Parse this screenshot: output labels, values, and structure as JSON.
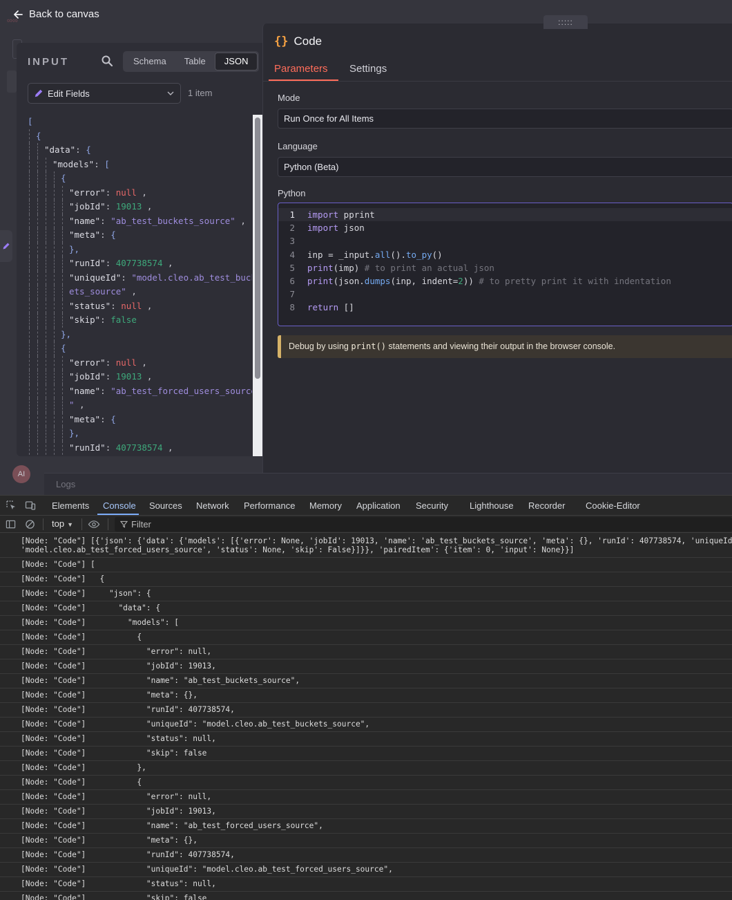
{
  "nav": {
    "back_label": "Back to canvas"
  },
  "canvas": {
    "logo_text": "∞∞",
    "ai_badge": "AI",
    "logs_label": "Logs"
  },
  "input": {
    "title": "INPUT",
    "view_tabs": [
      "Schema",
      "Table",
      "JSON"
    ],
    "active_view": "JSON",
    "node_selector": "Edit Fields",
    "item_count": "1 item",
    "json_lines": [
      {
        "i": 0,
        "k": "",
        "v": "[",
        "t": "p"
      },
      {
        "i": 1,
        "k": "",
        "v": "{",
        "t": "p"
      },
      {
        "i": 2,
        "k": "\"data\"",
        "v": "{",
        "t": "p"
      },
      {
        "i": 3,
        "k": "\"models\"",
        "v": "[",
        "t": "p"
      },
      {
        "i": 4,
        "k": "",
        "v": "{",
        "t": "p"
      },
      {
        "i": 5,
        "k": "\"error\"",
        "v": "null",
        "t": "null",
        "c": true
      },
      {
        "i": 5,
        "k": "\"jobId\"",
        "v": "19013",
        "t": "num",
        "c": true
      },
      {
        "i": 5,
        "k": "\"name\"",
        "v": "\"ab_test_buckets_source\"",
        "t": "str",
        "c": true
      },
      {
        "i": 5,
        "k": "\"meta\"",
        "v": "{",
        "t": "p"
      },
      {
        "i": 5,
        "k": "",
        "v": "},",
        "t": "p"
      },
      {
        "i": 5,
        "k": "\"runId\"",
        "v": "407738574",
        "t": "num",
        "c": true
      },
      {
        "i": 5,
        "k": "\"uniqueId\"",
        "v": "\"model.cleo.ab_test_buck",
        "t": "str"
      },
      {
        "i": 5,
        "k": "",
        "v": "    ets_source\"",
        "t": "str",
        "c": true
      },
      {
        "i": 5,
        "k": "\"status\"",
        "v": "null",
        "t": "null",
        "c": true
      },
      {
        "i": 5,
        "k": "\"skip\"",
        "v": "false",
        "t": "bool"
      },
      {
        "i": 4,
        "k": "",
        "v": "},",
        "t": "p"
      },
      {
        "i": 4,
        "k": "",
        "v": "{",
        "t": "p"
      },
      {
        "i": 5,
        "k": "\"error\"",
        "v": "null",
        "t": "null",
        "c": true
      },
      {
        "i": 5,
        "k": "\"jobId\"",
        "v": "19013",
        "t": "num",
        "c": true
      },
      {
        "i": 5,
        "k": "\"name\"",
        "v": "\"ab_test_forced_users_source",
        "t": "str"
      },
      {
        "i": 5,
        "k": "",
        "v": "     \"",
        "t": "str",
        "c": true
      },
      {
        "i": 5,
        "k": "\"meta\"",
        "v": "{",
        "t": "p"
      },
      {
        "i": 5,
        "k": "",
        "v": "},",
        "t": "p"
      },
      {
        "i": 5,
        "k": "\"runId\"",
        "v": "407738574",
        "t": "num",
        "c": true
      }
    ]
  },
  "node": {
    "icon": "{}",
    "title": "Code",
    "tabs": [
      "Parameters",
      "Settings"
    ],
    "active_tab": "Parameters",
    "mode_label": "Mode",
    "mode_value": "Run Once for All Items",
    "language_label": "Language",
    "language_value": "Python (Beta)",
    "editor_label": "Python",
    "code_lines": [
      {
        "n": "1",
        "html": "<span class=\"kw\">import</span> pprint"
      },
      {
        "n": "2",
        "html": "<span class=\"kw\">import</span> json"
      },
      {
        "n": "3",
        "html": ""
      },
      {
        "n": "4",
        "html": "inp = _input.<span class=\"fn\">all</span>().<span class=\"fn\">to_py</span>()"
      },
      {
        "n": "5",
        "html": "<span class=\"kw\">print</span>(imp) <span class=\"cm\"># to print an actual json</span>"
      },
      {
        "n": "6",
        "html": "<span class=\"kw\">print</span>(json.<span class=\"fn\">dumps</span>(inp, indent=<span class=\"nm\">2</span>)) <span class=\"cm\"># to pretty print it with indentation</span>"
      },
      {
        "n": "7",
        "html": ""
      },
      {
        "n": "8",
        "html": "<span class=\"kw\">return</span> []"
      }
    ],
    "hint_prefix": "Debug by using ",
    "hint_code": "print()",
    "hint_suffix": " statements and viewing their output in the browser console."
  },
  "devtools": {
    "tabs": [
      "Elements",
      "Console",
      "Sources",
      "Network",
      "Performance",
      "Memory",
      "Application",
      "Security",
      "Lighthouse",
      "Recorder",
      "Cookie-Editor"
    ],
    "active_tab": "Console",
    "context": "top",
    "filter_placeholder": "Filter",
    "first_message_line1": "[Node: \"Code\"] [{'json': {'data': {'models': [{'error': None, 'jobId': 19013, 'name': 'ab_test_buckets_source', 'meta': {}, 'runId': 407738574, 'uniqueId':",
    "first_message_line2": "'model.cleo.ab_test_forced_users_source', 'status': None, 'skip': False}]}}, 'pairedItem': {'item': 0, 'input': None}}]",
    "messages": [
      "[Node: \"Code\"] [",
      "[Node: \"Code\"]   {",
      "[Node: \"Code\"]     \"json\": {",
      "[Node: \"Code\"]       \"data\": {",
      "[Node: \"Code\"]         \"models\": [",
      "[Node: \"Code\"]           {",
      "[Node: \"Code\"]             \"error\": null,",
      "[Node: \"Code\"]             \"jobId\": 19013,",
      "[Node: \"Code\"]             \"name\": \"ab_test_buckets_source\",",
      "[Node: \"Code\"]             \"meta\": {},",
      "[Node: \"Code\"]             \"runId\": 407738574,",
      "[Node: \"Code\"]             \"uniqueId\": \"model.cleo.ab_test_buckets_source\",",
      "[Node: \"Code\"]             \"status\": null,",
      "[Node: \"Code\"]             \"skip\": false",
      "[Node: \"Code\"]           },",
      "[Node: \"Code\"]           {",
      "[Node: \"Code\"]             \"error\": null,",
      "[Node: \"Code\"]             \"jobId\": 19013,",
      "[Node: \"Code\"]             \"name\": \"ab_test_forced_users_source\",",
      "[Node: \"Code\"]             \"meta\": {},",
      "[Node: \"Code\"]             \"runId\": 407738574,",
      "[Node: \"Code\"]             \"uniqueId\": \"model.cleo.ab_test_forced_users_source\",",
      "[Node: \"Code\"]             \"status\": null,",
      "[Node: \"Code\"]             \"skip\": false"
    ]
  },
  "colors": {
    "accent": "#ff6d5a",
    "code_icon": "#f5a142",
    "selection": "#a8c7fa"
  }
}
